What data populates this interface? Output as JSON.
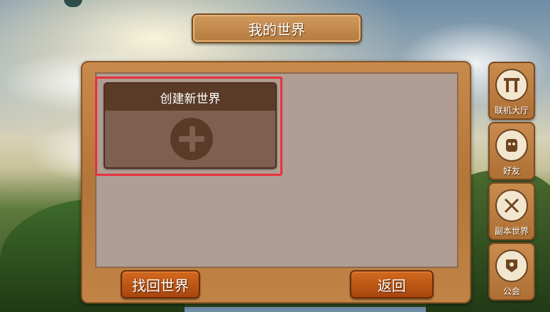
{
  "header": {
    "title": "我的世界"
  },
  "create_card": {
    "title": "创建新世界",
    "icon": "plus-icon"
  },
  "buttons": {
    "recover": "找回世界",
    "back": "返回"
  },
  "sidebar": {
    "items": [
      {
        "label": "联机大厅",
        "icon": "lobby-gate-icon"
      },
      {
        "label": "好友",
        "icon": "friend-face-icon"
      },
      {
        "label": "副本世界",
        "icon": "crossed-swords-icon"
      },
      {
        "label": "公会",
        "icon": "guild-banner-icon"
      }
    ]
  },
  "colors": {
    "highlight": "#e8313e",
    "button_orange": "#c25a16",
    "panel_wood": "#c18446",
    "panel_inner": "#b09d93"
  }
}
